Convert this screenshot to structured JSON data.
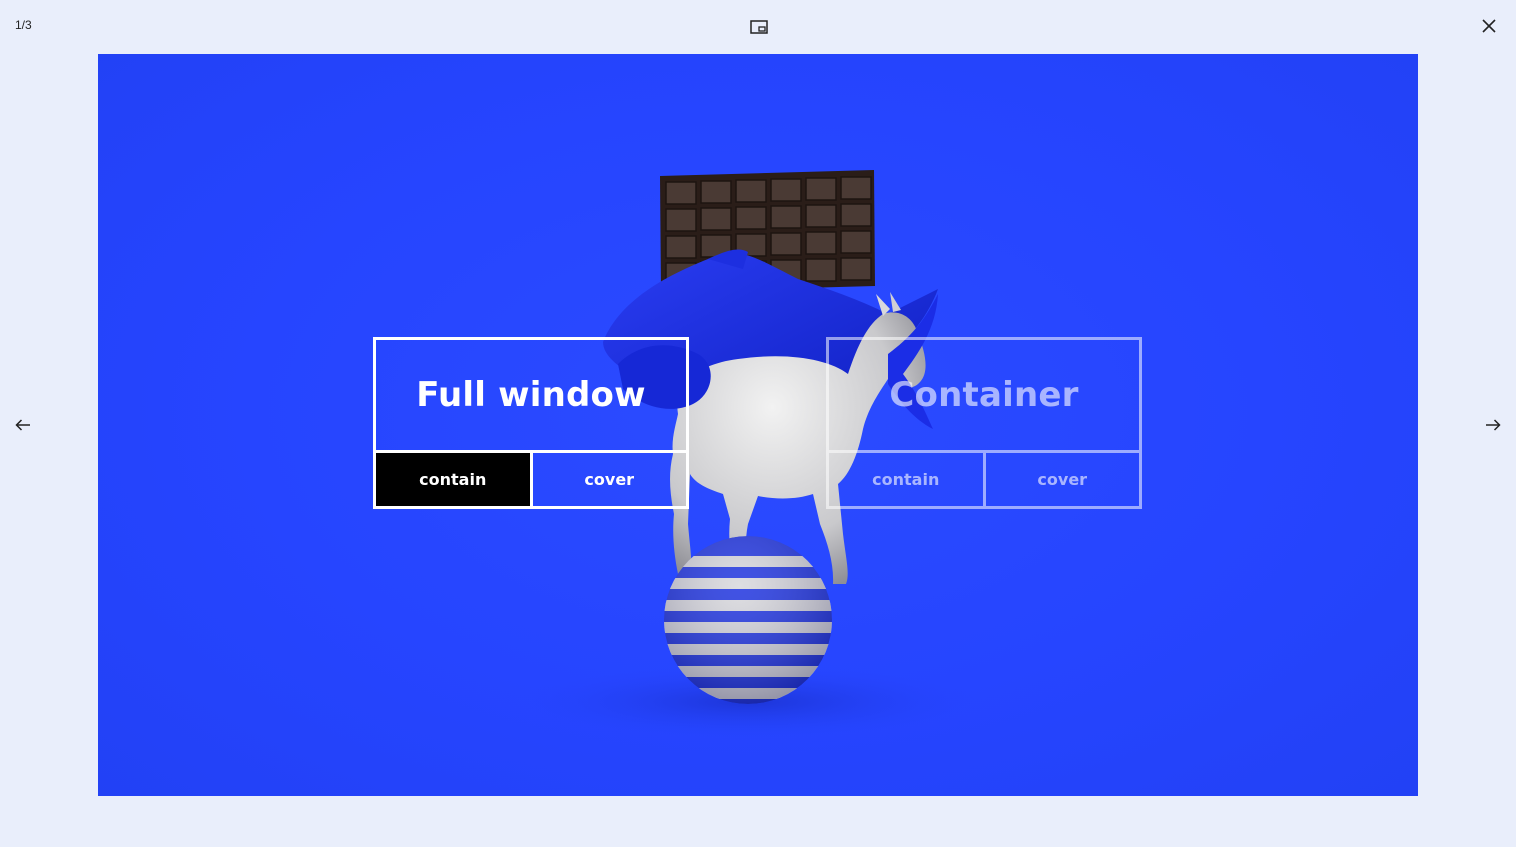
{
  "viewer": {
    "counter": "1/3"
  },
  "icons": {
    "pip": "picture-in-picture-icon",
    "close": "close-icon",
    "prev": "arrow-left-icon",
    "next": "arrow-right-icon"
  },
  "stage": {
    "background_color": "#2645ff",
    "image_alt": "3D render of a white horse balancing on a blue and white striped ball, wrapped in a blue cloth with a chocolate bar on top"
  },
  "panels": {
    "full_window": {
      "title": "Full window",
      "contain_label": "contain",
      "cover_label": "cover",
      "active": "contain"
    },
    "container": {
      "title": "Container",
      "contain_label": "contain",
      "cover_label": "cover"
    }
  },
  "colors": {
    "page_background": "#e9eefb",
    "accent_blue": "#2645ff",
    "active_button": "#000000",
    "text_light": "#ffffff"
  }
}
